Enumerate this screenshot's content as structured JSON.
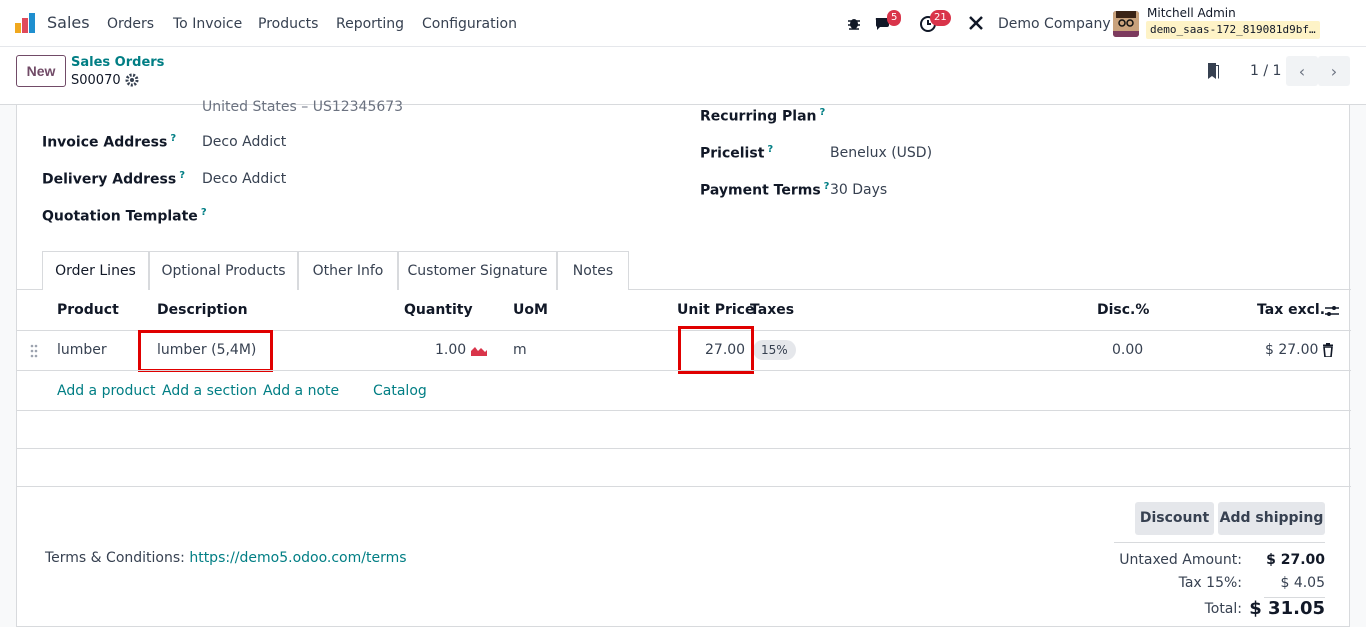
{
  "navbar": {
    "app_name": "Sales",
    "menu": [
      "Orders",
      "To Invoice",
      "Products",
      "Reporting",
      "Configuration"
    ],
    "messages_badge": "5",
    "activities_badge": "21",
    "company": "Demo Company",
    "user_name": "Mitchell Admin",
    "db_name": "demo_saas-172_819081d9bf…"
  },
  "control": {
    "new_label": "New",
    "breadcrumb": "Sales Orders",
    "record": "S00070",
    "pager": "1 / 1"
  },
  "form": {
    "partial_address": "United States – US12345673",
    "invoice_address_label": "Invoice Address",
    "invoice_address": "Deco Addict",
    "delivery_address_label": "Delivery Address",
    "delivery_address": "Deco Addict",
    "quotation_template_label": "Quotation Template",
    "recurring_plan_label": "Recurring Plan",
    "pricelist_label": "Pricelist",
    "pricelist": "Benelux (USD)",
    "payment_terms_label": "Payment Terms",
    "payment_terms": "30 Days",
    "help_mark": "?"
  },
  "tabs": [
    "Order Lines",
    "Optional Products",
    "Other Info",
    "Customer Signature",
    "Notes"
  ],
  "table": {
    "headers": {
      "product": "Product",
      "description": "Description",
      "quantity": "Quantity",
      "uom": "UoM",
      "unit_price": "Unit Price",
      "taxes": "Taxes",
      "disc": "Disc.%",
      "tax_excl": "Tax excl."
    },
    "row": {
      "product": "lumber",
      "description": "lumber (5,4M)",
      "quantity": "1.00",
      "uom": "m",
      "unit_price": "27.00",
      "tax": "15%",
      "disc": "0.00",
      "subtotal": "$ 27.00"
    },
    "add_product": "Add a product",
    "add_section": "Add a section",
    "add_note": "Add a note",
    "catalog": "Catalog"
  },
  "buttons": {
    "discount": "Discount",
    "add_shipping": "Add shipping"
  },
  "terms": {
    "label": "Terms & Conditions:",
    "url": "https://demo5.odoo.com/terms"
  },
  "totals": {
    "untaxed_label": "Untaxed Amount:",
    "untaxed": "$ 27.00",
    "tax_label": "Tax 15%:",
    "tax": "$ 4.05",
    "total_label": "Total:",
    "total": "$ 31.05"
  },
  "colors": {
    "brand": "#714b67",
    "link": "#017e84",
    "highlight": "#e00000",
    "badge": "#d9344a"
  }
}
